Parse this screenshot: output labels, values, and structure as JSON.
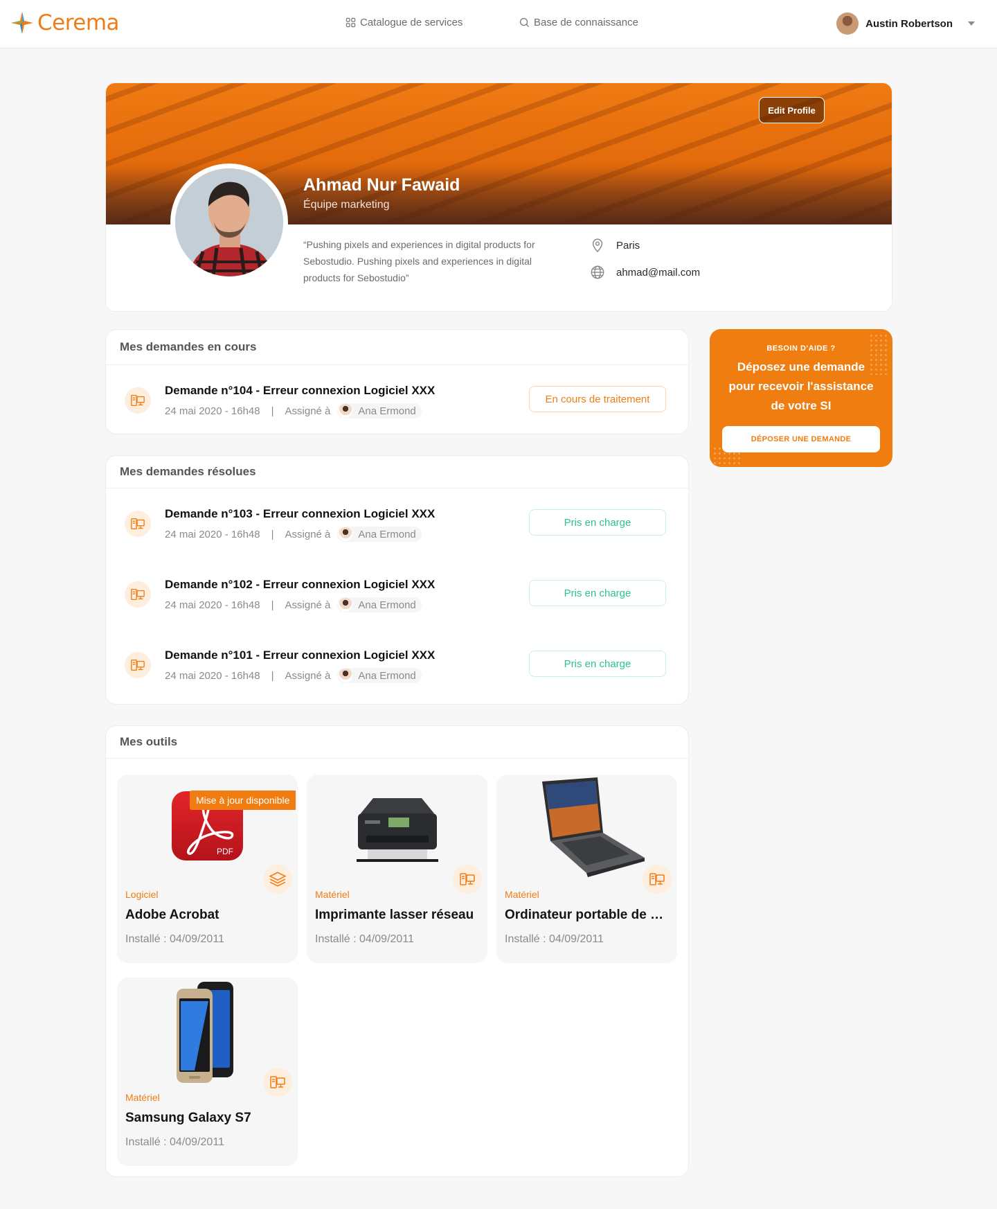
{
  "header": {
    "brand": "Cerema",
    "nav": [
      {
        "label": "Catalogue de services",
        "icon": "grid-icon"
      },
      {
        "label": "Base de connaissance",
        "icon": "search-icon"
      }
    ],
    "user": {
      "name": "Austin Robertson"
    }
  },
  "profile": {
    "edit_label": "Edit Profile",
    "name": "Ahmad Nur Fawaid",
    "team": "Équipe marketing",
    "quote": "“Pushing pixels and experiences in digital products for Sebostudio. Pushing pixels and experiences in digital products for Sebostudio”",
    "location": "Paris",
    "email": "ahmad@mail.com"
  },
  "in_progress": {
    "title": "Mes demandes en cours",
    "items": [
      {
        "title": "Demande n°104 - Erreur connexion Logiciel XXX",
        "date": "24 mai 2020 - 16h48",
        "sep": "|",
        "assigned_label": "Assigné à",
        "assignee": "Ana Ermond",
        "status": "En cours de traitement"
      }
    ]
  },
  "resolved": {
    "title": "Mes demandes résolues",
    "items": [
      {
        "title": "Demande n°103 - Erreur connexion Logiciel XXX",
        "date": "24 mai 2020 - 16h48",
        "sep": "|",
        "assigned_label": "Assigné à",
        "assignee": "Ana Ermond",
        "status": "Pris en charge"
      },
      {
        "title": "Demande n°102 - Erreur connexion Logiciel XXX",
        "date": "24 mai 2020 - 16h48",
        "sep": "|",
        "assigned_label": "Assigné à",
        "assignee": "Ana Ermond",
        "status": "Pris en charge"
      },
      {
        "title": "Demande n°101 - Erreur connexion Logiciel XXX",
        "date": "24 mai 2020 - 16h48",
        "sep": "|",
        "assigned_label": "Assigné à",
        "assignee": "Ana Ermond",
        "status": "Pris en charge"
      }
    ]
  },
  "help": {
    "kicker": "BESOIN D'AIDE ?",
    "text": "Déposez une demande pour recevoir l'assistance de votre SI",
    "button": "DÉPOSER UNE DEMANDE"
  },
  "tools": {
    "title": "Mes outils",
    "items": [
      {
        "category": "Logiciel",
        "name": "Adobe Acrobat",
        "installed": "Installé : 04/09/2011",
        "tag": "Mise à jour disponible",
        "pdf_label": "PDF"
      },
      {
        "category": "Matériel",
        "name": "Imprimante lasser réseau",
        "installed": "Installé : 04/09/2011"
      },
      {
        "category": "Matériel",
        "name": "Ordinateur portable de bureau",
        "installed": "Installé : 04/09/2011"
      },
      {
        "category": "Matériel",
        "name": "Samsung Galaxy S7",
        "installed": "Installé : 04/09/2011"
      }
    ]
  },
  "colors": {
    "accent": "#ef7d17",
    "success": "#2bc48a"
  }
}
